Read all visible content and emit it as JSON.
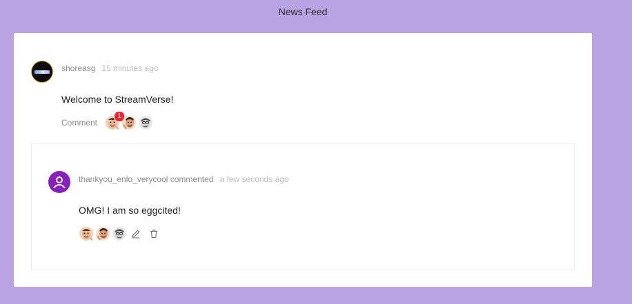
{
  "header": {
    "title": "News Feed"
  },
  "post": {
    "author": "shoreasg",
    "time": "15 minutes ago",
    "text": "Welcome to StreamVerse!",
    "comment_label": "Comment",
    "reactions": [
      {
        "emote": "face-emote-1",
        "count": "1"
      },
      {
        "emote": "face-emote-2",
        "count": null
      },
      {
        "emote": "face-emote-3",
        "count": null
      }
    ]
  },
  "comment": {
    "author_line": "thankyou_enlo_verycool commented",
    "time": "a few seconds ago",
    "text": "OMG! I am so eggcited!",
    "reactions": [
      {
        "emote": "face-emote-1"
      },
      {
        "emote": "face-emote-2"
      },
      {
        "emote": "face-emote-3"
      }
    ]
  },
  "colors": {
    "background": "#b8a3e3",
    "card": "#ffffff",
    "avatar_purple": "#8a1fbf",
    "badge_red": "#f5222d",
    "meta_gray": "#8c8c8c",
    "time_gray": "#bfbfbf"
  },
  "icons": {
    "edit": "pencil-icon",
    "delete": "trash-icon",
    "user": "user-icon"
  }
}
